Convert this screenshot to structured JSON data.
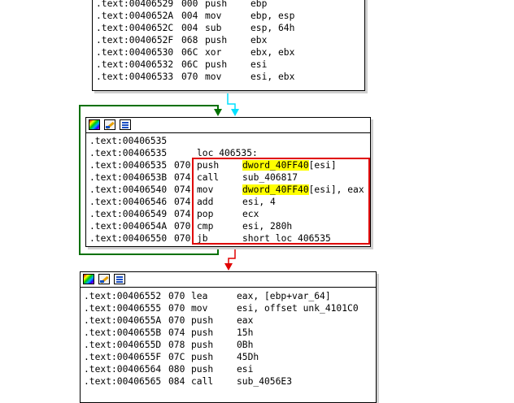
{
  "block_top": {
    "rows": [
      {
        "addr": ".text:00406529",
        "sp": "000",
        "mnem": "push",
        "ops": "ebp"
      },
      {
        "addr": ".text:0040652A",
        "sp": "004",
        "mnem": "mov",
        "ops": "ebp, esp"
      },
      {
        "addr": ".text:0040652C",
        "sp": "004",
        "mnem": "sub",
        "ops": "esp, 64h"
      },
      {
        "addr": ".text:0040652F",
        "sp": "068",
        "mnem": "push",
        "ops": "ebx"
      },
      {
        "addr": ".text:00406530",
        "sp": "06C",
        "mnem": "xor",
        "ops": "ebx, ebx"
      },
      {
        "addr": ".text:00406532",
        "sp": "06C",
        "mnem": "push",
        "ops": "esi"
      },
      {
        "addr": ".text:00406533",
        "sp": "070",
        "mnem": "mov",
        "ops": "esi, ebx"
      }
    ]
  },
  "block_loop": {
    "toolbar": [
      "color-icon",
      "pencil-icon",
      "graph-icon"
    ],
    "addr_only": ".text:00406535",
    "label_row": {
      "addr": ".text:00406535",
      "label": "loc_406535:"
    },
    "rows": [
      {
        "addr": ".text:00406535",
        "sp": "070",
        "mnem": "push",
        "op_hl": "dword_40FF40",
        "op_rest": "[esi]"
      },
      {
        "addr": ".text:0040653B",
        "sp": "074",
        "mnem": "call",
        "op_hl": "",
        "op_rest": "sub_406817"
      },
      {
        "addr": ".text:00406540",
        "sp": "074",
        "mnem": "mov",
        "op_hl": "dword_40FF40",
        "op_rest": "[esi], eax"
      },
      {
        "addr": ".text:00406546",
        "sp": "074",
        "mnem": "add",
        "op_hl": "",
        "op_rest": "esi, 4"
      },
      {
        "addr": ".text:00406549",
        "sp": "074",
        "mnem": "pop",
        "op_hl": "",
        "op_rest": "ecx"
      },
      {
        "addr": ".text:0040654A",
        "sp": "070",
        "mnem": "cmp",
        "op_hl": "",
        "op_rest": "esi, 280h"
      },
      {
        "addr": ".text:00406550",
        "sp": "070",
        "mnem": "jb",
        "op_hl": "",
        "op_rest": "short loc_406535"
      }
    ]
  },
  "block_bottom": {
    "toolbar": [
      "color-icon",
      "pencil-icon",
      "graph-icon"
    ],
    "rows": [
      {
        "addr": ".text:00406552",
        "sp": "070",
        "mnem": "lea",
        "ops": "eax, [ebp+var_64]"
      },
      {
        "addr": ".text:00406555",
        "sp": "070",
        "mnem": "mov",
        "ops": "esi, offset unk_4101C0"
      },
      {
        "addr": ".text:0040655A",
        "sp": "070",
        "mnem": "push",
        "ops": "eax"
      },
      {
        "addr": ".text:0040655B",
        "sp": "074",
        "mnem": "push",
        "ops": "15h"
      },
      {
        "addr": ".text:0040655D",
        "sp": "078",
        "mnem": "push",
        "ops": "0Bh"
      },
      {
        "addr": ".text:0040655F",
        "sp": "07C",
        "mnem": "push",
        "ops": "45Dh"
      },
      {
        "addr": ".text:00406564",
        "sp": "080",
        "mnem": "push",
        "ops": "esi"
      },
      {
        "addr": ".text:00406565",
        "sp": "084",
        "mnem": "call",
        "ops": "sub_4056E3"
      }
    ]
  },
  "colors": {
    "highlight": "#ffff00",
    "selection_box": "#e00000",
    "edge_loop_back": "#007000",
    "edge_fallthrough": "#00e0ff",
    "edge_false": "#e00000"
  }
}
